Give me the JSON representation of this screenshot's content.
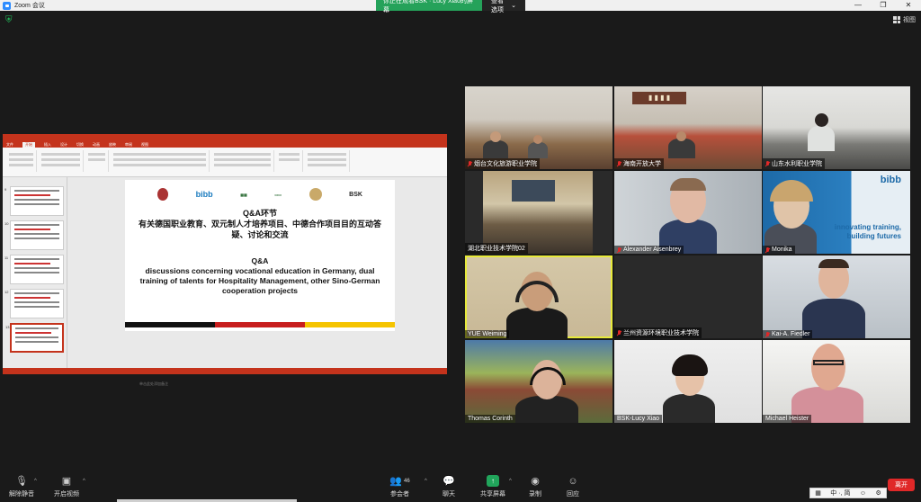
{
  "window": {
    "title": "Zoom 会议",
    "share_banner": "你正在观看BSK · Lucy Xiao的屏幕",
    "view_options": "查看选项",
    "view_button": "视图"
  },
  "presentation": {
    "title": "Q&A环节",
    "chinese_subtitle": "有关德国职业教育、双元制人才培养项目、中德合作项目目的互动答疑、讨论和交流",
    "en_title": "Q&A",
    "en_subtitle": "discussions concerning vocational education in Germany, dual training of talents for Hospitality Management, other Sino-German cooperation projects",
    "logos": [
      "bibb",
      "BSK"
    ],
    "slide_numbers": [
      "9",
      "10",
      "11",
      "12",
      "13"
    ],
    "notes_placeholder": "单击此处添加备注"
  },
  "participants": [
    {
      "name": "烟台文化旅游职业学院",
      "muted": true
    },
    {
      "name": "海南开放大学",
      "muted": true
    },
    {
      "name": "山东水利职业学院",
      "muted": true
    },
    {
      "name": "湖北职业技术学院02",
      "muted": false
    },
    {
      "name": "Alexander Aisenbrey",
      "muted": true
    },
    {
      "name": "Monika",
      "muted": true
    },
    {
      "name": "YUE Weiming",
      "muted": false
    },
    {
      "name": "兰州资源环境职业技术学院",
      "muted": true
    },
    {
      "name": "Kai-A. Fiedler",
      "muted": true
    },
    {
      "name": "Thomas Corinth",
      "muted": false
    },
    {
      "name": "BSK-Lucy Xiao",
      "muted": false
    },
    {
      "name": "Michael Heister",
      "muted": false
    }
  ],
  "bibb_tile": {
    "line1": "innovating training,",
    "line2": "building futures"
  },
  "toolbar": {
    "unmute": "解除静音",
    "start_video": "开启视频",
    "participants": "参会者",
    "participant_count": "46",
    "chat": "聊天",
    "share": "共享屏幕",
    "record": "录制",
    "reactions": "回应",
    "leave": "离开"
  },
  "ime": {
    "text": "中 ·, 简"
  },
  "colors": {
    "share_green": "#25a25a",
    "leave_red": "#e02828",
    "active_speaker": "#e7ea3a",
    "ppt_red": "#c4331c"
  }
}
